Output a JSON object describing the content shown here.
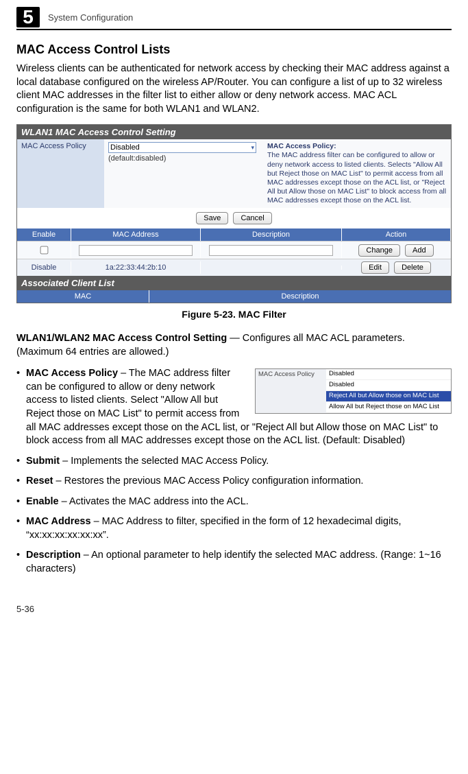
{
  "header": {
    "chapter_number": "5",
    "chapter_title": "System Configuration"
  },
  "section_title": "MAC Access Control Lists",
  "intro_paragraph": "Wireless clients can be authenticated for network access by checking their MAC address against a local database configured on the wireless AP/Router. You can configure a list of up to 32 wireless client MAC addresses in the filter list to either allow or deny network access. MAC ACL configuration is the same for both WLAN1 and WLAN2.",
  "figure": {
    "panel_title": "WLAN1 MAC Access Control Setting",
    "policy_label": "MAC Access Policy",
    "policy_selected": "Disabled",
    "policy_default_note": "(default:disabled)",
    "policy_help_title": "MAC Access Policy:",
    "policy_help_body": "The MAC address filter can be configured to allow or deny network access to listed clients.\nSelects \"Allow All but Reject those on MAC List\" to permit access from all MAC addresses except those on the ACL list, or \"Reject All but Allow those on MAC List\" to block access from all MAC addresses except those on the ACL list.",
    "save_label": "Save",
    "cancel_label": "Cancel",
    "columns": {
      "enable": "Enable",
      "mac": "MAC Address",
      "desc": "Description",
      "action": "Action"
    },
    "row_buttons": {
      "change": "Change",
      "add": "Add",
      "edit": "Edit",
      "delete": "Delete"
    },
    "existing_row": {
      "enable": "Disable",
      "mac": "1a:22:33:44:2b:10",
      "desc": ""
    },
    "assoc_title": "Associated Client List",
    "assoc_columns": {
      "mac": "MAC",
      "desc": "Description"
    },
    "caption": "Figure 5-23.   MAC Filter"
  },
  "post_figure_lead": {
    "bold": "WLAN1/WLAN2 MAC Access Control Setting",
    "rest": " — Configures all MAC ACL parameters. (Maximum 64 entries are allowed.)"
  },
  "policy_inset": {
    "label": "MAC Access Policy",
    "options": [
      "Disabled",
      "Disabled",
      "Reject All but Allow those on MAC List",
      "Allow All but Reject those on MAC List"
    ],
    "selected_index": 2
  },
  "bullets": [
    {
      "term": "MAC Access Policy",
      "body": " – The MAC address filter can be configured to allow or deny network access to listed clients. Select \"Allow All but Reject those on MAC List\" to permit access from all MAC addresses except those on the ACL list, or \"Reject All but Allow those on MAC List\" to block access from all MAC addresses except those on the ACL list. (Default: Disabled)"
    },
    {
      "term": "Submit",
      "body": " – Implements the selected MAC Access Policy."
    },
    {
      "term": "Reset",
      "body": " – Restores the previous MAC Access Policy configuration information."
    },
    {
      "term": "Enable",
      "body": " – Activates the MAC address into the ACL."
    },
    {
      "term": "MAC Address",
      "body": " – MAC Address to filter, specified in the form of 12 hexadecimal digits, “xx:xx:xx:xx:xx:xx”."
    },
    {
      "term": "Description",
      "body": " – An optional parameter to help identify the selected MAC address. (Range: 1~16 characters)"
    }
  ],
  "page_number": "5-36"
}
